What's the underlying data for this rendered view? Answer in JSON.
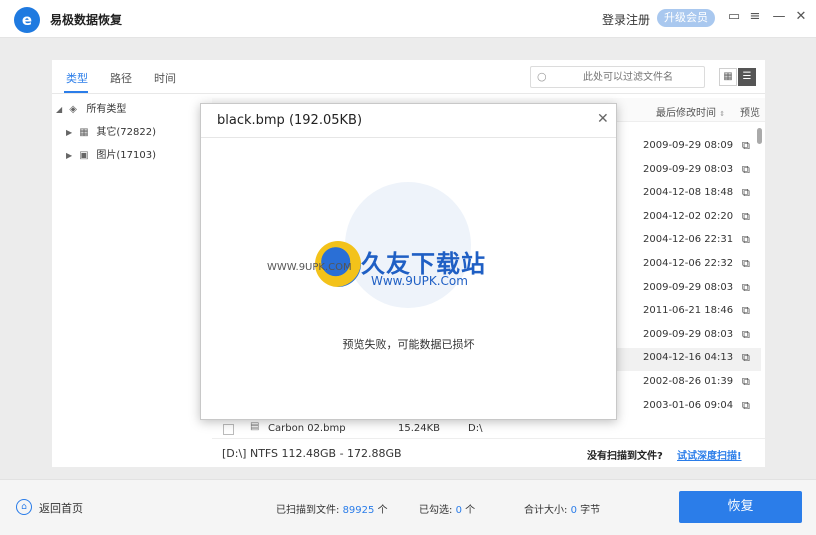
{
  "app": {
    "title": "易极数据恢复",
    "login": "登录注册",
    "upgrade": "升级会员",
    "controls": {
      "feedback": "feedback-icon",
      "menu": "menu-icon",
      "minimize": "minimize-icon",
      "close": "close-icon"
    }
  },
  "tabs": [
    "类型",
    "路径",
    "时间"
  ],
  "filter": {
    "placeholder": "此处可以过滤文件名"
  },
  "tree": {
    "root": "所有类型",
    "items": [
      {
        "label": "其它(72822)"
      },
      {
        "label": "图片(17103)"
      }
    ]
  },
  "table": {
    "headers": {
      "modified": "最后修改时间",
      "preview": "预览"
    },
    "dates": [
      "2009-09-29 08:09",
      "2009-09-29 08:03",
      "2004-12-08 18:48",
      "2004-12-02 02:20",
      "2004-12-06 22:31",
      "2004-12-06 22:32",
      "2009-09-29 08:03",
      "2011-06-21 18:46",
      "2009-09-29 08:03",
      "2004-12-16 04:13",
      "2002-08-26 01:39",
      "2003-01-06 09:04"
    ],
    "visible_row": {
      "name": "Carbon 02.bmp",
      "size": "15.24KB",
      "path": "D:\\"
    }
  },
  "status": {
    "disk": "[D:\\] NTFS 112.48GB - 172.88GB",
    "no_file": "没有扫描到文件?",
    "deep_scan": "试试深度扫描!"
  },
  "dialog": {
    "title": "black.bmp  (192.05KB)",
    "message": "预览失败，可能数据已损坏",
    "watermark_small": "WWW.9UPK.COM",
    "watermark_big": "久友下载站",
    "watermark_url": "Www.9UPK.Com"
  },
  "footer": {
    "home": "返回首页",
    "scanned_label": "已扫描到文件:",
    "scanned": "89925",
    "scanned_unit": "个",
    "checked_label": "已勾选:",
    "checked": "0",
    "checked_unit": "个",
    "total_label": "合计大小:",
    "total": "0",
    "total_unit": "字节",
    "recover": "恢复"
  }
}
